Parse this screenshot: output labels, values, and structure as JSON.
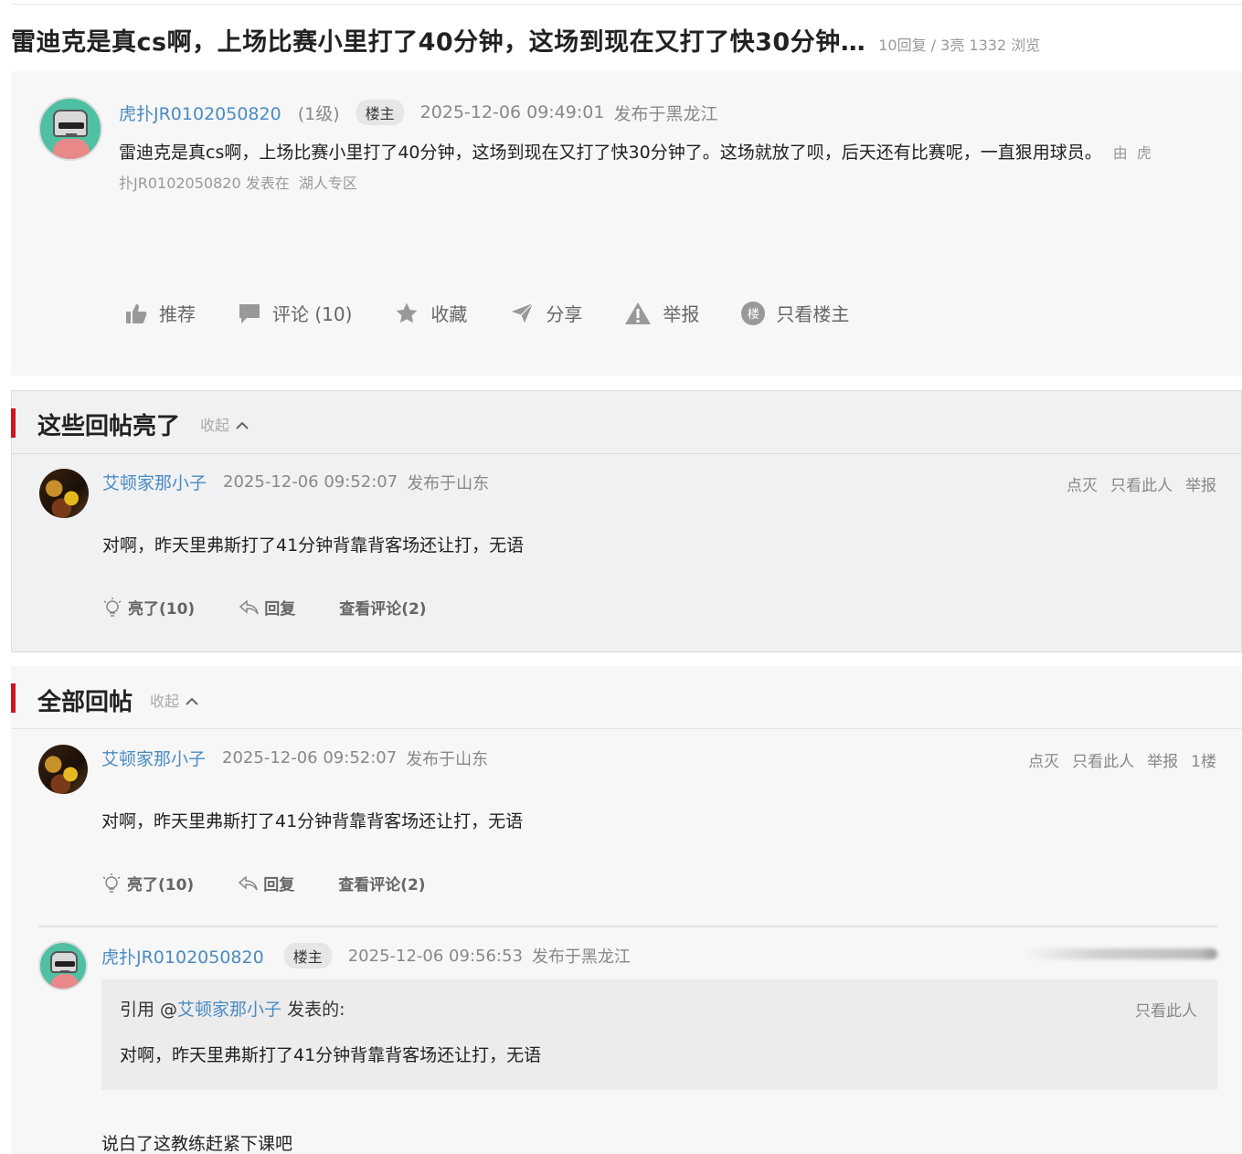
{
  "thread": {
    "title": "雷迪克是真cs啊，上场比赛小里打了40分钟，这场到现在又打了快30分钟…",
    "stats": "10回复 / 3亮 1332 浏览"
  },
  "main_post": {
    "username": "虎扑JR0102050820",
    "level": "(1级)",
    "badge": "楼主",
    "datetime": "2025-12-06 09:49:01",
    "location": "发布于黑龙江",
    "body": "雷迪克是真cs啊，上场比赛小里打了40分钟，这场到现在又打了快30分钟了。这场就放了呗，后天还有比赛呢，一直狠用球员。",
    "source_prefix": "由",
    "source_user": "虎扑JR0102050820",
    "source_mid": "发表在",
    "source_board": "湖人专区",
    "actions": {
      "recommend": "推荐",
      "comment": "评论 (10)",
      "favorite": "收藏",
      "share": "分享",
      "report": "举报",
      "lou_glyph": "楼",
      "only_op": "只看楼主"
    }
  },
  "highlight_section": {
    "title": "这些回帖亮了",
    "collapse": "收起",
    "reply": {
      "username": "艾顿家那小子",
      "datetime": "2025-12-06 09:52:07",
      "location": "发布于山东",
      "dislike": "点灭",
      "only_this": "只看此人",
      "report": "举报",
      "text": "对啊，昨天里弗斯打了41分钟背靠背客场还让打，无语",
      "light": "亮了(10)",
      "reply": "回复",
      "view_comments": "查看评论(2)"
    }
  },
  "all_section": {
    "title": "全部回帖",
    "collapse": "收起",
    "reply1": {
      "username": "艾顿家那小子",
      "datetime": "2025-12-06 09:52:07",
      "location": "发布于山东",
      "dislike": "点灭",
      "only_this": "只看此人",
      "report": "举报",
      "floor": "1楼",
      "text": "对啊，昨天里弗斯打了41分钟背靠背客场还让打，无语",
      "light": "亮了(10)",
      "reply": "回复",
      "view_comments": "查看评论(2)"
    },
    "reply2": {
      "username": "虎扑JR0102050820",
      "badge": "楼主",
      "datetime": "2025-12-06 09:56:53",
      "location": "发布于黑龙江",
      "quote_prefix": "引用 @",
      "quote_user": "艾顿家那小子",
      "quote_suffix": " 发表的:",
      "quote_only_this": "只看此人",
      "quote_text": "对啊，昨天里弗斯打了41分钟背靠背客场还让打，无语",
      "text": "说白了这教练赶紧下课吧"
    }
  },
  "colors": {
    "accent_red": "#d0141e",
    "link_blue": "#4a8bc2",
    "muted_gray": "#888888"
  }
}
